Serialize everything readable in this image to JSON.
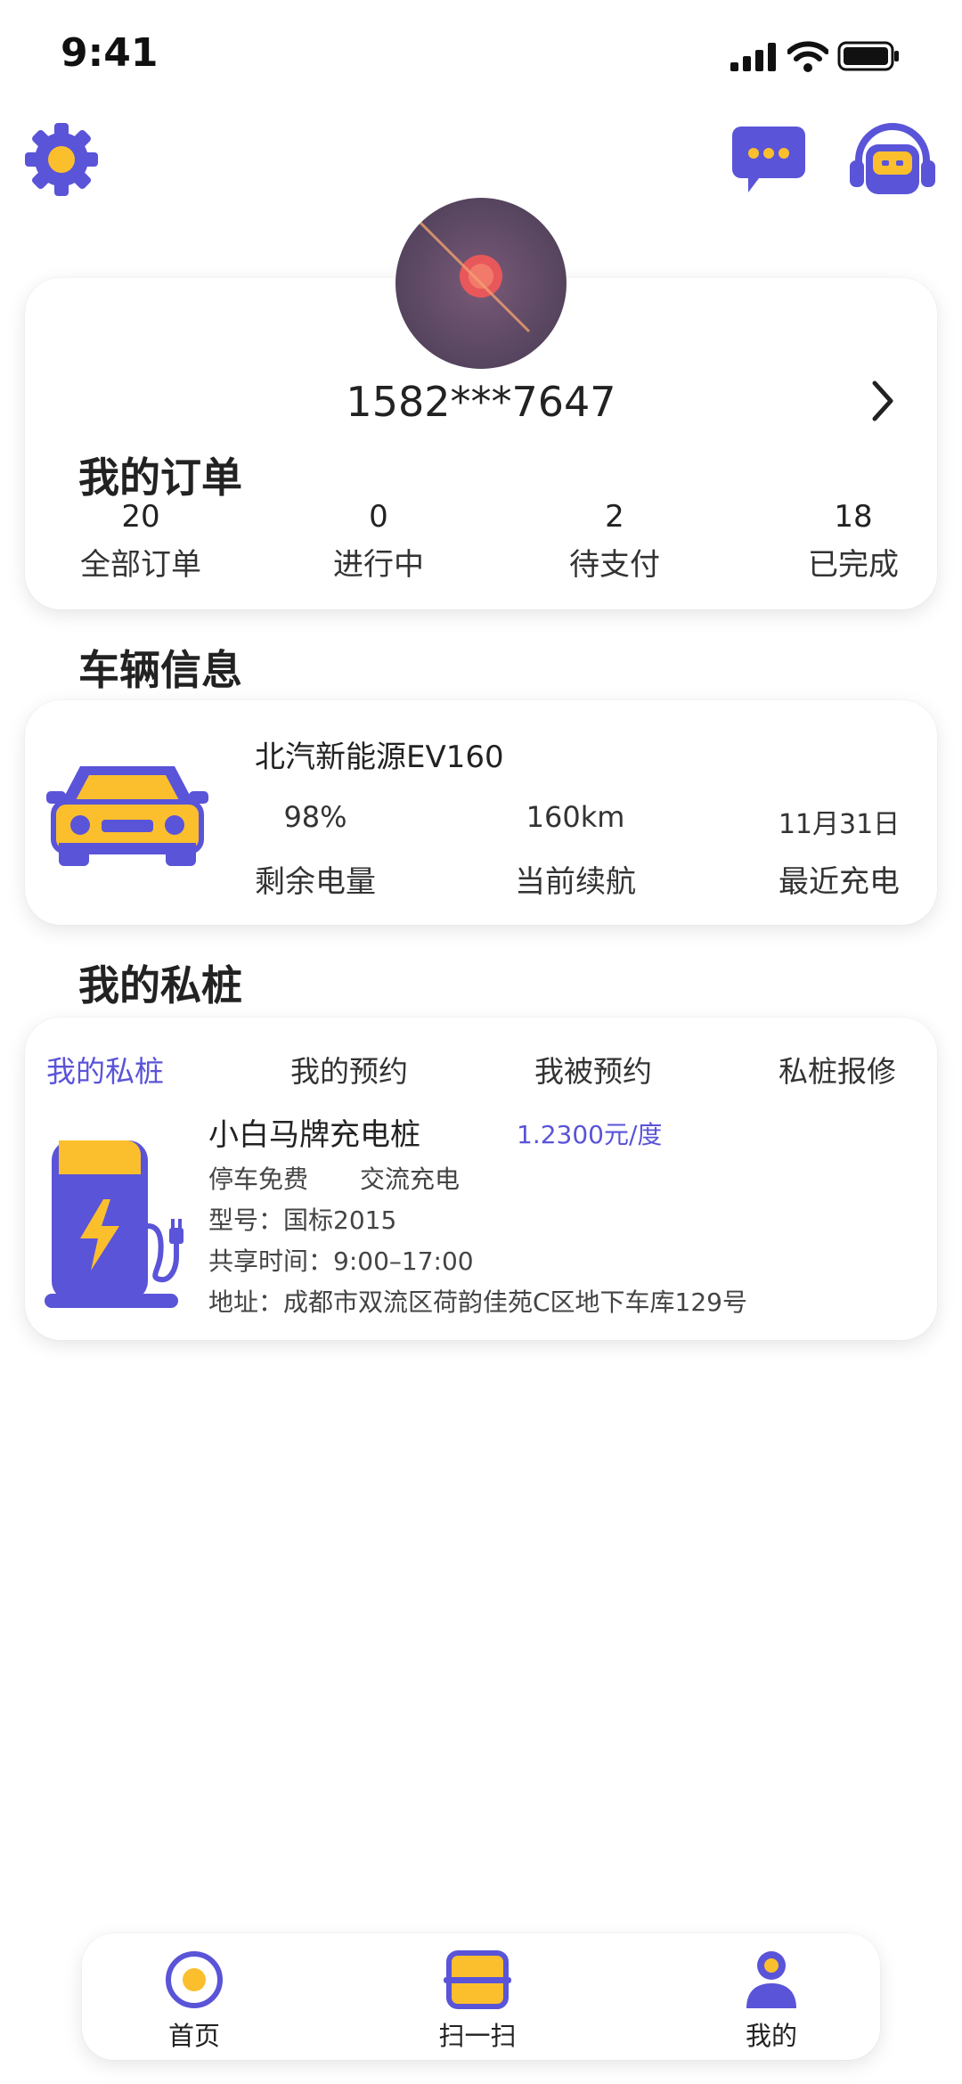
{
  "status_bar": {
    "time": "9:41"
  },
  "header": {
    "settings_icon": "gear-icon",
    "message_icon": "chat-bubble-icon",
    "support_icon": "headset-icon"
  },
  "profile": {
    "phone": "1582***7647",
    "avatar": "avatar-image"
  },
  "orders": {
    "title": "我的订单",
    "stats": [
      {
        "count": "20",
        "label": "全部订单"
      },
      {
        "count": "0",
        "label": "进行中"
      },
      {
        "count": "2",
        "label": "待支付"
      },
      {
        "count": "18",
        "label": "已完成"
      }
    ]
  },
  "vehicle": {
    "section_title": "车辆信息",
    "model": "北汽新能源EV160",
    "stats": [
      {
        "value": "98%",
        "label": "剩余电量"
      },
      {
        "value": "160km",
        "label": "当前续航"
      },
      {
        "value": "11月31日",
        "label": "最近充电"
      }
    ]
  },
  "pile": {
    "section_title": "我的私桩",
    "tabs": [
      "我的私桩",
      "我的预约",
      "我被预约",
      "私桩报修"
    ],
    "active_tab": 0,
    "name": "小白马牌充电桩",
    "price": "1.2300元/度",
    "tags": [
      "停车免费",
      "交流充电"
    ],
    "model": "型号：国标2015",
    "share_time": "共享时间：9:00–17:00",
    "address": "地址：成都市双流区荷韵佳苑C区地下车库129号"
  },
  "bottom_nav": {
    "items": [
      {
        "label": "首页",
        "icon": "home-icon"
      },
      {
        "label": "扫一扫",
        "icon": "scan-icon"
      },
      {
        "label": "我的",
        "icon": "user-icon"
      }
    ]
  },
  "colors": {
    "accent": "#5a54d8",
    "yellow": "#fbbf2d"
  }
}
